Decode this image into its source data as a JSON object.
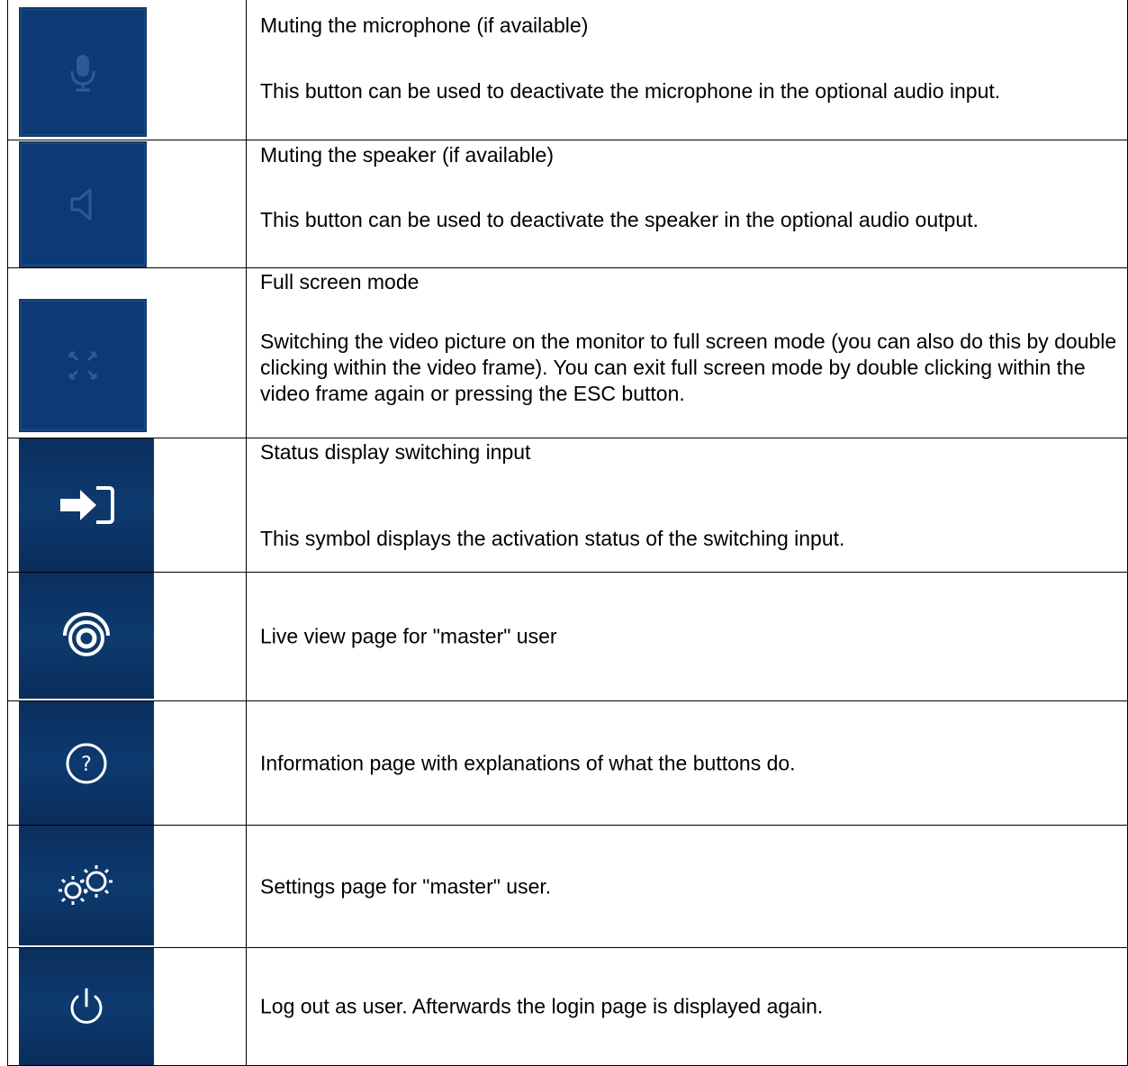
{
  "rows": [
    {
      "icon": "microphone-icon",
      "title": "Muting the microphone (if available)",
      "description": "This button can be used to deactivate the microphone in the optional audio input."
    },
    {
      "icon": "speaker-icon",
      "title": "Muting the speaker (if available)",
      "description": "This button can be used to deactivate the speaker in the optional audio output."
    },
    {
      "icon": "fullscreen-icon",
      "title": "Full screen mode",
      "description": "Switching the video picture on the monitor to full screen mode (you can also do this by double clicking within the video frame). You can exit full screen mode by double clicking within the video frame again or pressing the ESC button."
    },
    {
      "icon": "switching-input-icon",
      "title": "Status display switching input",
      "description": "This symbol displays the activation status of the switching input."
    },
    {
      "icon": "live-view-icon",
      "text": "Live view page for \"master\" user"
    },
    {
      "icon": "help-icon",
      "text": "Information page with explanations of what the buttons do."
    },
    {
      "icon": "settings-gears-icon",
      "text": "Settings page for \"master\" user."
    },
    {
      "icon": "power-icon",
      "text": "Log out as user. Afterwards the login page is displayed again."
    }
  ],
  "colors": {
    "button_blue": "#003c7e",
    "icon_dim": "#2f5a94",
    "icon_bright": "#ffffff"
  }
}
